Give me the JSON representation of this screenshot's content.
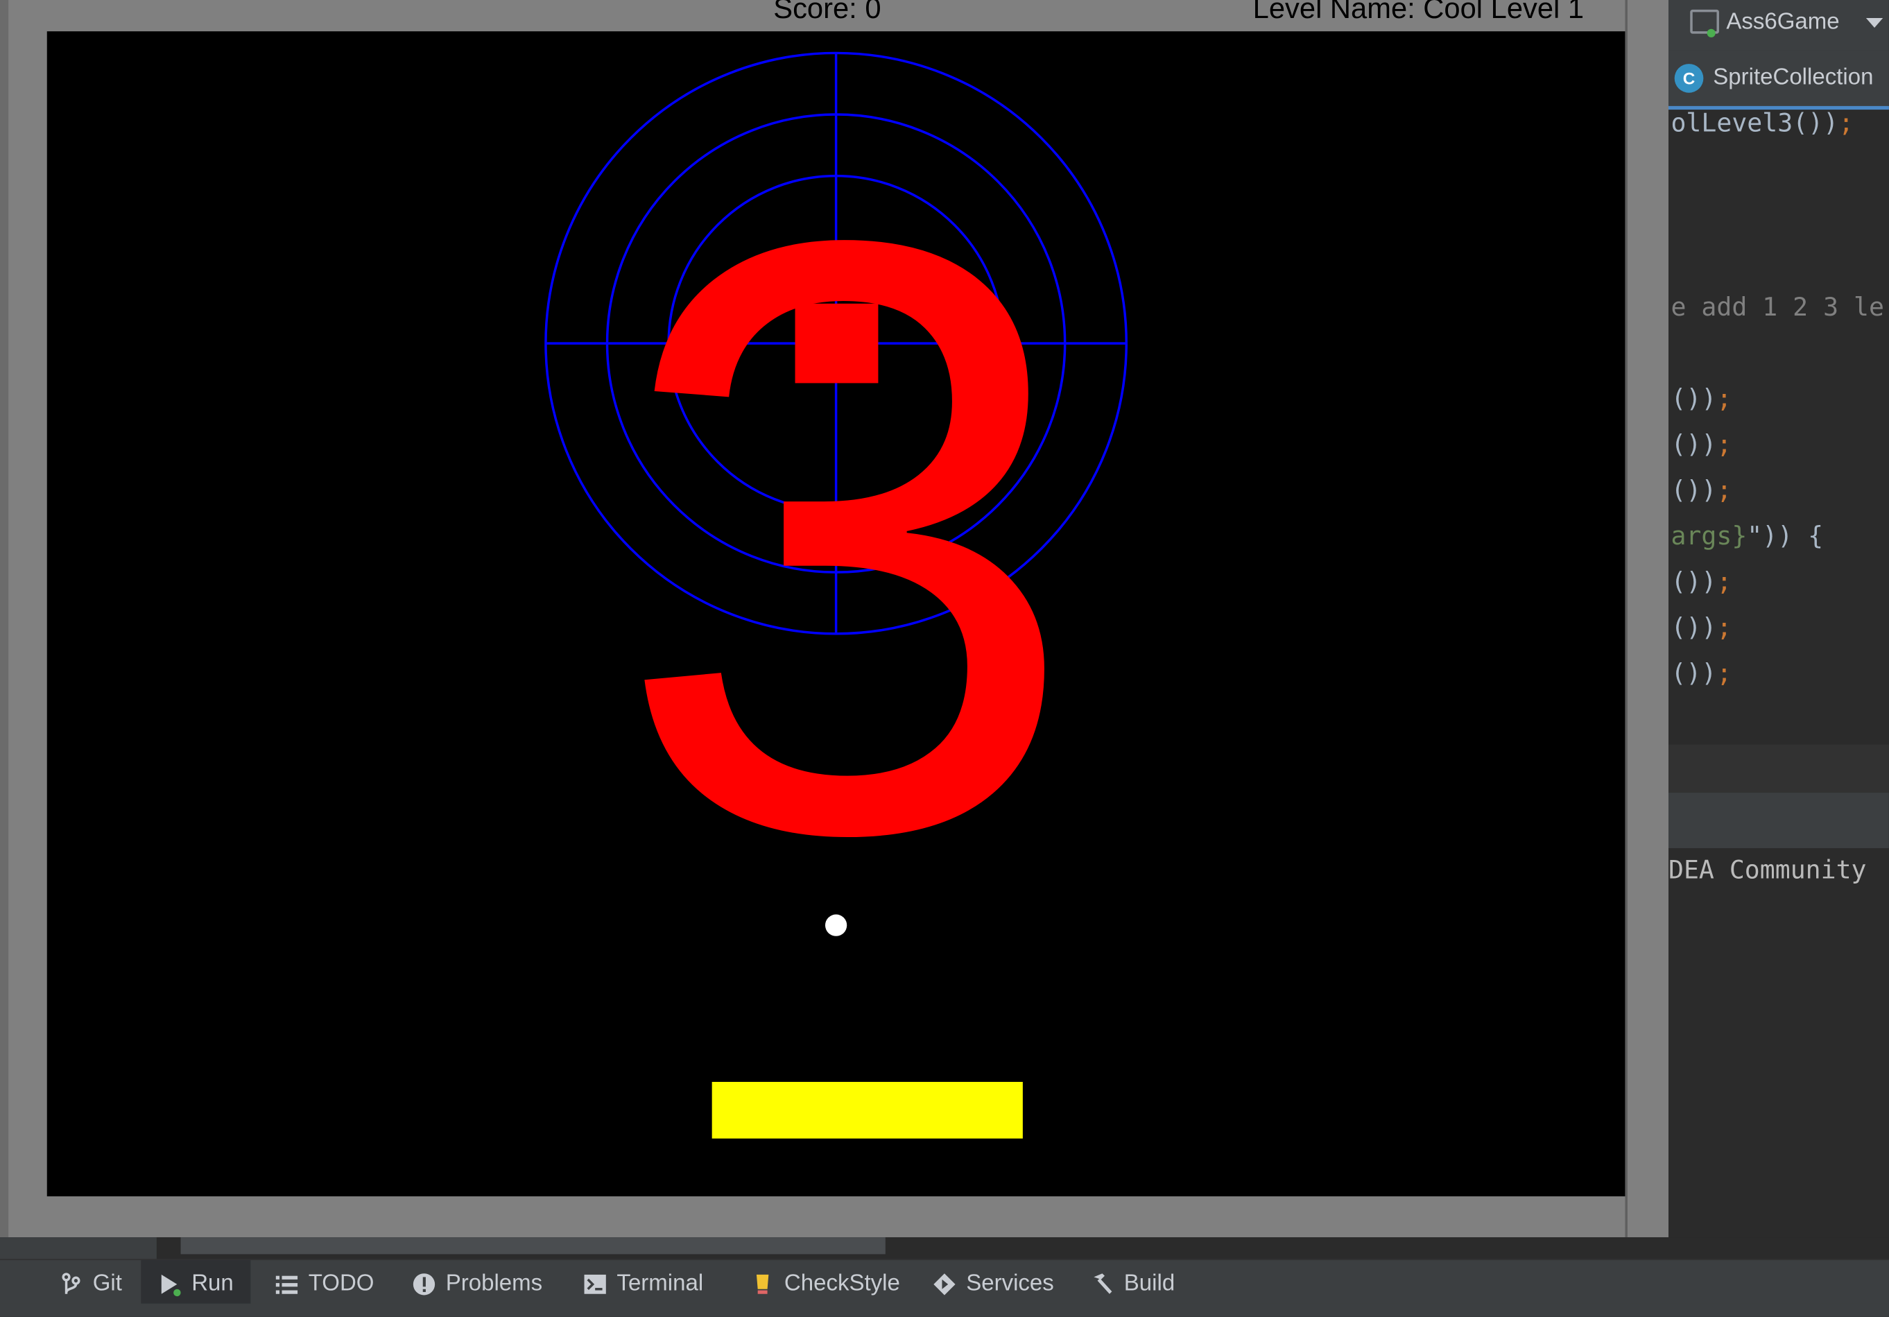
{
  "game": {
    "score_text": "Score: 0",
    "level_text": "Level Name: Cool Level 1",
    "countdown": "3",
    "colors": {
      "canvas_bg": "#000000",
      "target": "#0000ff",
      "countdown": "#ff0000",
      "block": "#ff0000",
      "ball": "#ffffff",
      "paddle": "#ffff00",
      "window_frame": "#808080"
    }
  },
  "ide": {
    "run_config": "Ass6Game",
    "editor_tab": "SpriteCollection",
    "code_lines": [
      {
        "text": "olLevel3())",
        "semi": ";"
      },
      {
        "comment": "e add 1 2 3 le"
      },
      {
        "text": "())",
        "semi": ";"
      },
      {
        "text": "())",
        "semi": ";"
      },
      {
        "text": "())",
        "semi": ";"
      },
      {
        "str": "args}",
        "text": "\")) {"
      },
      {
        "text": "())",
        "semi": ";"
      },
      {
        "text": "())",
        "semi": ";"
      },
      {
        "text": "())",
        "semi": ";"
      }
    ],
    "console_text": "DEA Community"
  },
  "toolbar": {
    "items": [
      {
        "label": "Git",
        "icon": "git-branch-icon"
      },
      {
        "label": "Run",
        "icon": "run-icon"
      },
      {
        "label": "TODO",
        "icon": "list-icon"
      },
      {
        "label": "Problems",
        "icon": "warning-icon"
      },
      {
        "label": "Terminal",
        "icon": "terminal-icon"
      },
      {
        "label": "CheckStyle",
        "icon": "checkstyle-icon"
      },
      {
        "label": "Services",
        "icon": "services-icon"
      },
      {
        "label": "Build",
        "icon": "hammer-icon"
      }
    ]
  }
}
